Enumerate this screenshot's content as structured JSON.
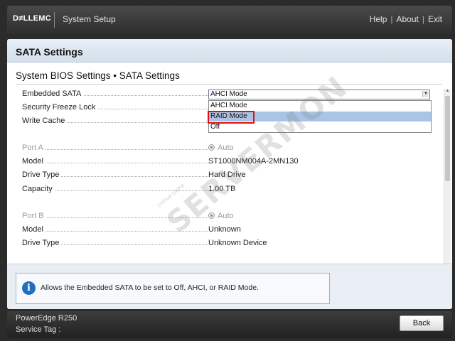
{
  "topbar": {
    "logo": "D≠LLEMC",
    "title": "System Setup",
    "links": {
      "help": "Help",
      "about": "About",
      "exit": "Exit",
      "sep": "|"
    }
  },
  "page": {
    "title": "SATA Settings",
    "breadcrumb": "System BIOS Settings • SATA Settings"
  },
  "settings": {
    "embedded_sata": {
      "label": "Embedded SATA",
      "value": "AHCI Mode"
    },
    "security_freeze_lock": {
      "label": "Security Freeze Lock"
    },
    "write_cache": {
      "label": "Write Cache"
    },
    "dropdown_options": [
      "AHCI Mode",
      "RAID Mode",
      "Off"
    ],
    "highlighted_option": "RAID Mode",
    "port_a": {
      "label": "Port A",
      "value": "Auto",
      "model_label": "Model",
      "model": "ST1000NM004A-2MN130",
      "drive_type_label": "Drive Type",
      "drive_type": "Hard Drive",
      "capacity_label": "Capacity",
      "capacity": "1.00 TB"
    },
    "port_b": {
      "label": "Port B",
      "value": "Auto",
      "model_label": "Model",
      "model": "Unknown",
      "drive_type_label": "Drive Type",
      "drive_type": "Unknown Device"
    }
  },
  "help": {
    "text": "Allows the Embedded SATA to be set to Off, AHCI, or RAID Mode.",
    "icon": "i"
  },
  "footer": {
    "model": "PowerEdge R250",
    "service_tag": "Service Tag :",
    "back_label": "Back"
  },
  "watermark": {
    "text": "SERVERMON",
    "sub": "статьи сайта"
  },
  "colors": {
    "highlight": "#a9c4e4",
    "annotation_red": "#e01010",
    "info_blue": "#1f6fbf"
  }
}
